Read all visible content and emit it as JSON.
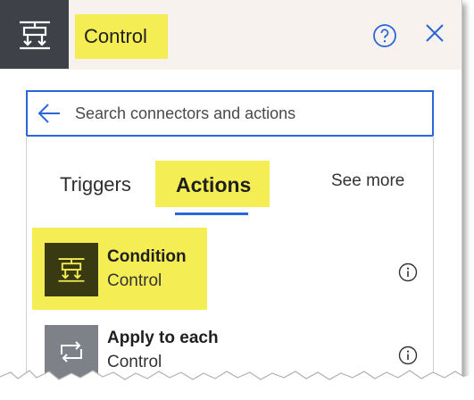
{
  "header": {
    "title": "Control",
    "icon": "control-icon",
    "help_icon": "help-icon",
    "close_icon": "close-icon"
  },
  "search": {
    "placeholder": "Search connectors and actions",
    "back_icon": "back-arrow-icon"
  },
  "tabs": [
    {
      "label": "Triggers",
      "selected": false
    },
    {
      "label": "Actions",
      "selected": true
    }
  ],
  "see_more": "See more",
  "items": [
    {
      "title": "Condition",
      "subtitle": "Control",
      "icon": "condition-icon",
      "info_icon": "info-icon"
    },
    {
      "title": "Apply to each",
      "subtitle": "Control",
      "icon": "loop-icon",
      "info_icon": "info-icon"
    }
  ],
  "colors": {
    "accent": "#2b66d9",
    "highlight": "#f4ee54",
    "header_icon_bg": "#3e4148",
    "condition_icon_bg": "#3a3a12",
    "loop_icon_bg": "#7e8187"
  }
}
